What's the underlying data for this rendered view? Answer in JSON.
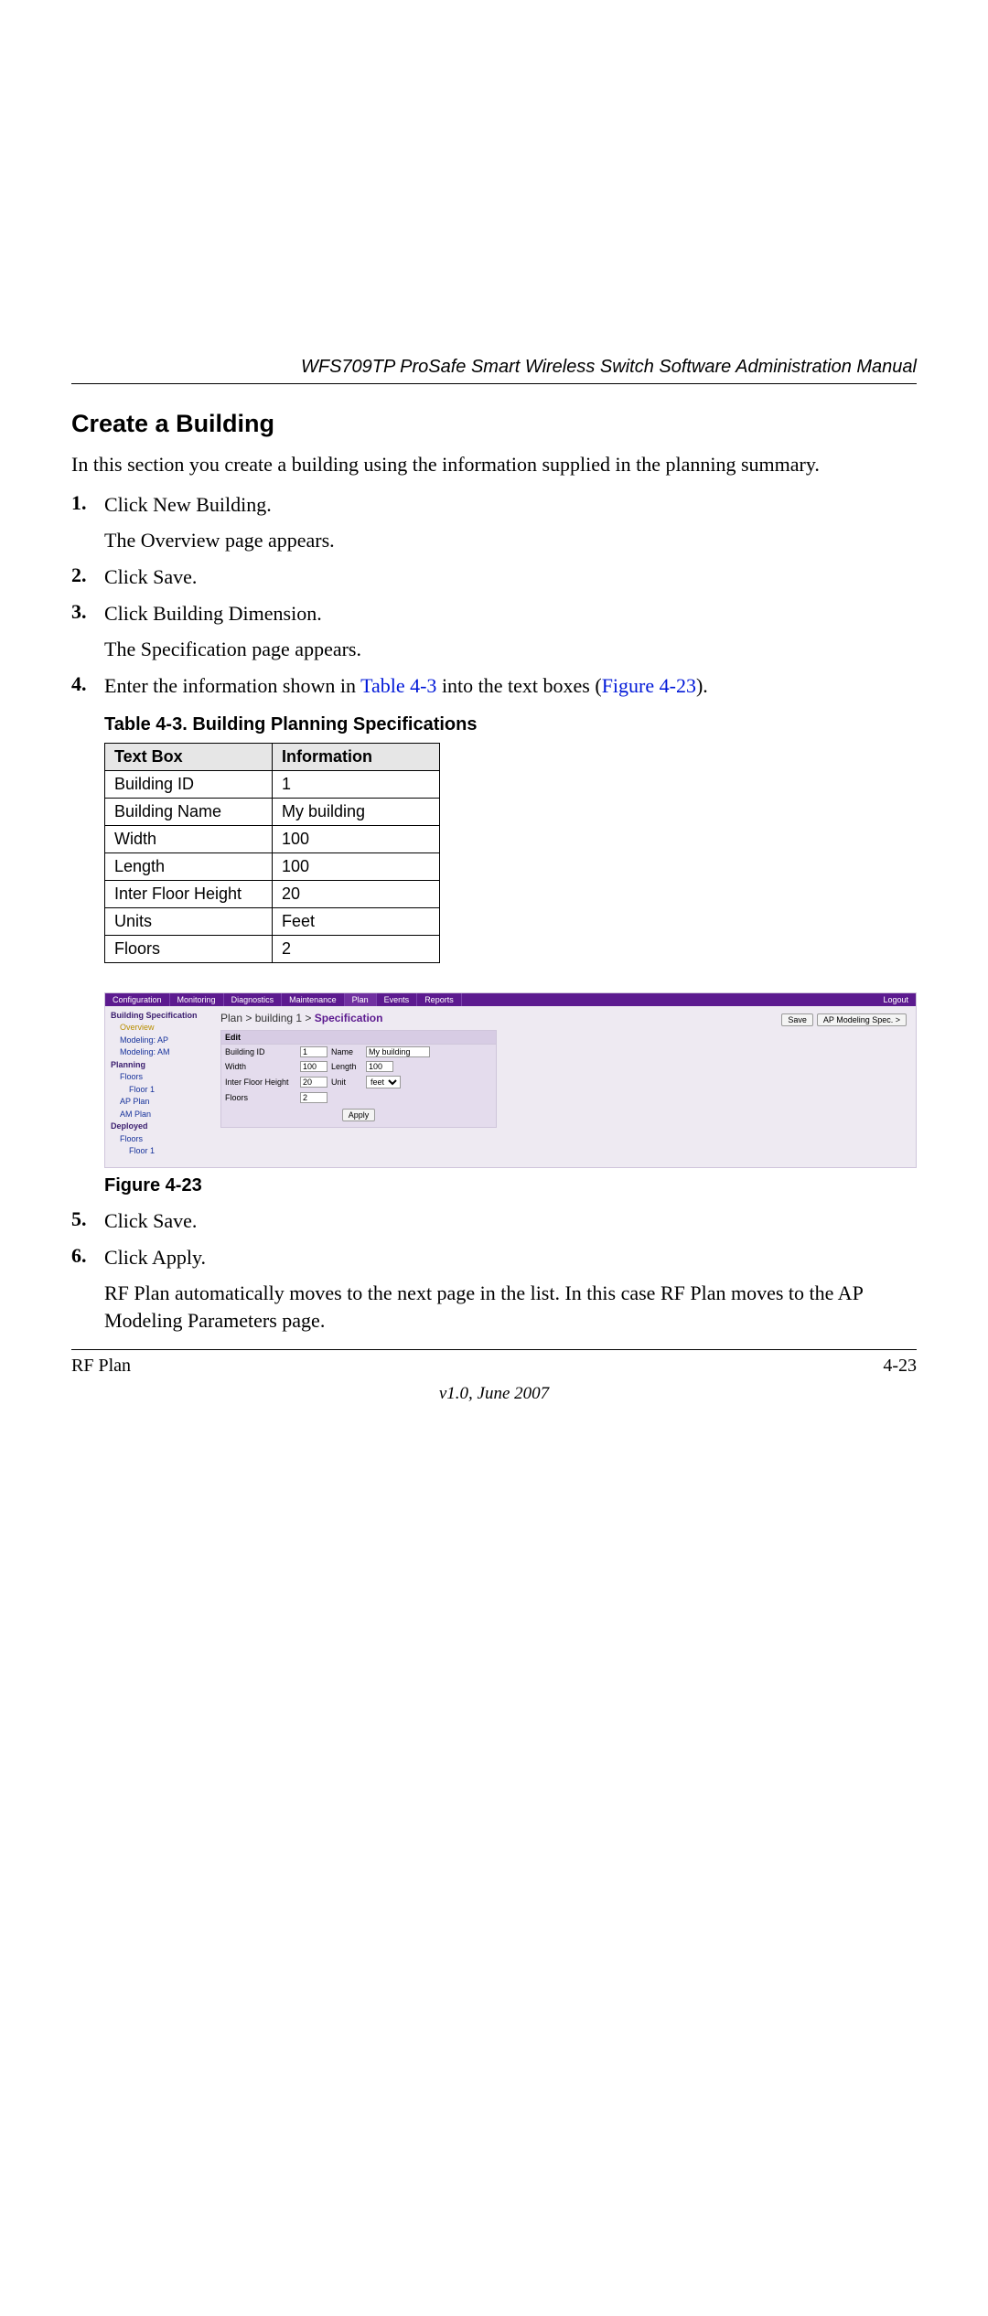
{
  "running_head": "WFS709TP ProSafe Smart Wireless Switch Software Administration Manual",
  "section_title": "Create a Building",
  "intro": "In this section you create a building using the information supplied in the planning summary.",
  "steps": {
    "s1": "Click New Building.",
    "s1_follow": "The Overview page appears.",
    "s2": "Click Save.",
    "s3": "Click Building Dimension.",
    "s3_follow": "The Specification page appears.",
    "s4_a": "Enter the information shown in ",
    "s4_link1": "Table 4-3",
    "s4_b": " into the text boxes (",
    "s4_link2": "Figure 4-23",
    "s4_c": ").",
    "s5": "Click Save.",
    "s6": "Click Apply.",
    "s6_follow": "RF Plan automatically moves to the next page in the list. In this case RF Plan moves to the AP Modeling Parameters page."
  },
  "table": {
    "caption": "Table 4-3. Building Planning Specifications",
    "h1": "Text Box",
    "h2": "Information",
    "r1c1": "Building ID",
    "r1c2": "1",
    "r2c1": "Building Name",
    "r2c2": "My building",
    "r3c1": "Width",
    "r3c2": "100",
    "r4c1": "Length",
    "r4c2": "100",
    "r5c1": "Inter Floor Height",
    "r5c2": "20",
    "r6c1": "Units",
    "r6c2": "Feet",
    "r7c1": "Floors",
    "r7c2": "2"
  },
  "ui": {
    "nav": {
      "t1": "Configuration",
      "t2": "Monitoring",
      "t3": "Diagnostics",
      "t4": "Maintenance",
      "t5": "Plan",
      "t6": "Events",
      "t7": "Reports",
      "logout": "Logout"
    },
    "side": {
      "h1": "Building Specification",
      "l_overview": "Overview",
      "l_modap": "Modeling: AP",
      "l_modam": "Modeling: AM",
      "h2": "Planning",
      "l_floors": "Floors",
      "l_floor1": "Floor 1",
      "l_applan": "AP Plan",
      "l_amplan": "AM Plan",
      "h3": "Deployed",
      "l_dfloors": "Floors",
      "l_dfloor1": "Floor 1"
    },
    "breadcrumb_a": "Plan > building 1 > ",
    "breadcrumb_b": "Specification",
    "btn_save": "Save",
    "btn_spec": "AP Modeling Spec. >",
    "panel_title": "Edit",
    "lbl_bid": "Building ID",
    "val_bid": "1",
    "lbl_name": "Name",
    "val_name": "My building",
    "lbl_width": "Width",
    "val_width": "100",
    "lbl_length": "Length",
    "val_length": "100",
    "lbl_ifh": "Inter Floor Height",
    "val_ifh": "20",
    "lbl_unit": "Unit",
    "val_unit": "feet",
    "lbl_floors": "Floors",
    "val_floors": "2",
    "btn_apply": "Apply"
  },
  "figure_label": "Figure 4-23",
  "footer": {
    "left": "RF Plan",
    "right": "4-23",
    "version": "v1.0, June 2007"
  }
}
